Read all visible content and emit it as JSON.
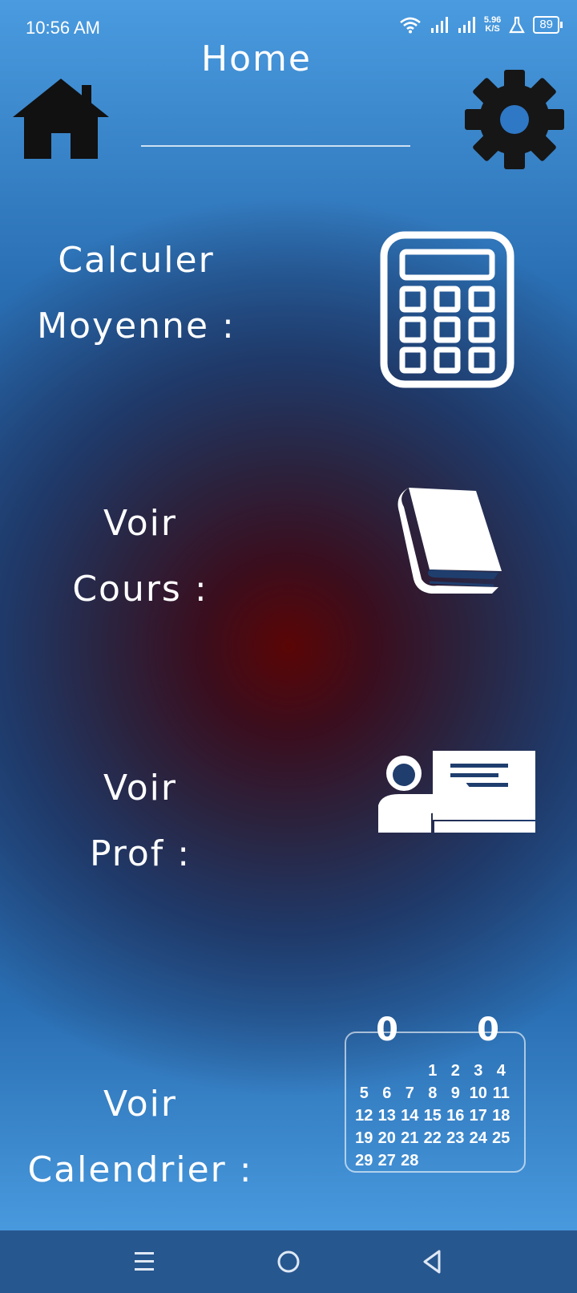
{
  "status_bar": {
    "time": "10:56 AM",
    "network_speed_value": "5.96",
    "network_speed_unit": "K/S",
    "battery": "89"
  },
  "header": {
    "title": "Home",
    "left_icon": "home-icon",
    "right_icon": "gear-icon"
  },
  "menu": [
    {
      "line1": "Calculer",
      "line2": "Moyenne :",
      "icon": "calculator-icon"
    },
    {
      "line1": "Voir",
      "line2": "Cours :",
      "icon": "book-icon"
    },
    {
      "line1": "Voir",
      "line2": "Prof :",
      "icon": "teacher-icon"
    },
    {
      "line1": "Voir",
      "line2": "Calendrier :",
      "icon": "calendar-icon"
    }
  ],
  "calendar": {
    "ring_left": "0",
    "ring_right": "0",
    "days": [
      "",
      "",
      "",
      "1",
      "2",
      "3",
      "4",
      "5",
      "6",
      "7",
      "8",
      "9",
      "10",
      "11",
      "12",
      "13",
      "14",
      "15",
      "16",
      "17",
      "18",
      "19",
      "20",
      "21",
      "22",
      "23",
      "24",
      "25",
      "29",
      "27",
      "28"
    ]
  },
  "nav_bar": {
    "icons": [
      "menu-icon",
      "home-circle-icon",
      "back-icon"
    ]
  },
  "colors": {
    "bg_top": "#4a9be0",
    "bg_mid": "#1d5496",
    "center_glow": "#5a0505",
    "icon_dark": "#111111",
    "icon_white": "#ffffff"
  }
}
